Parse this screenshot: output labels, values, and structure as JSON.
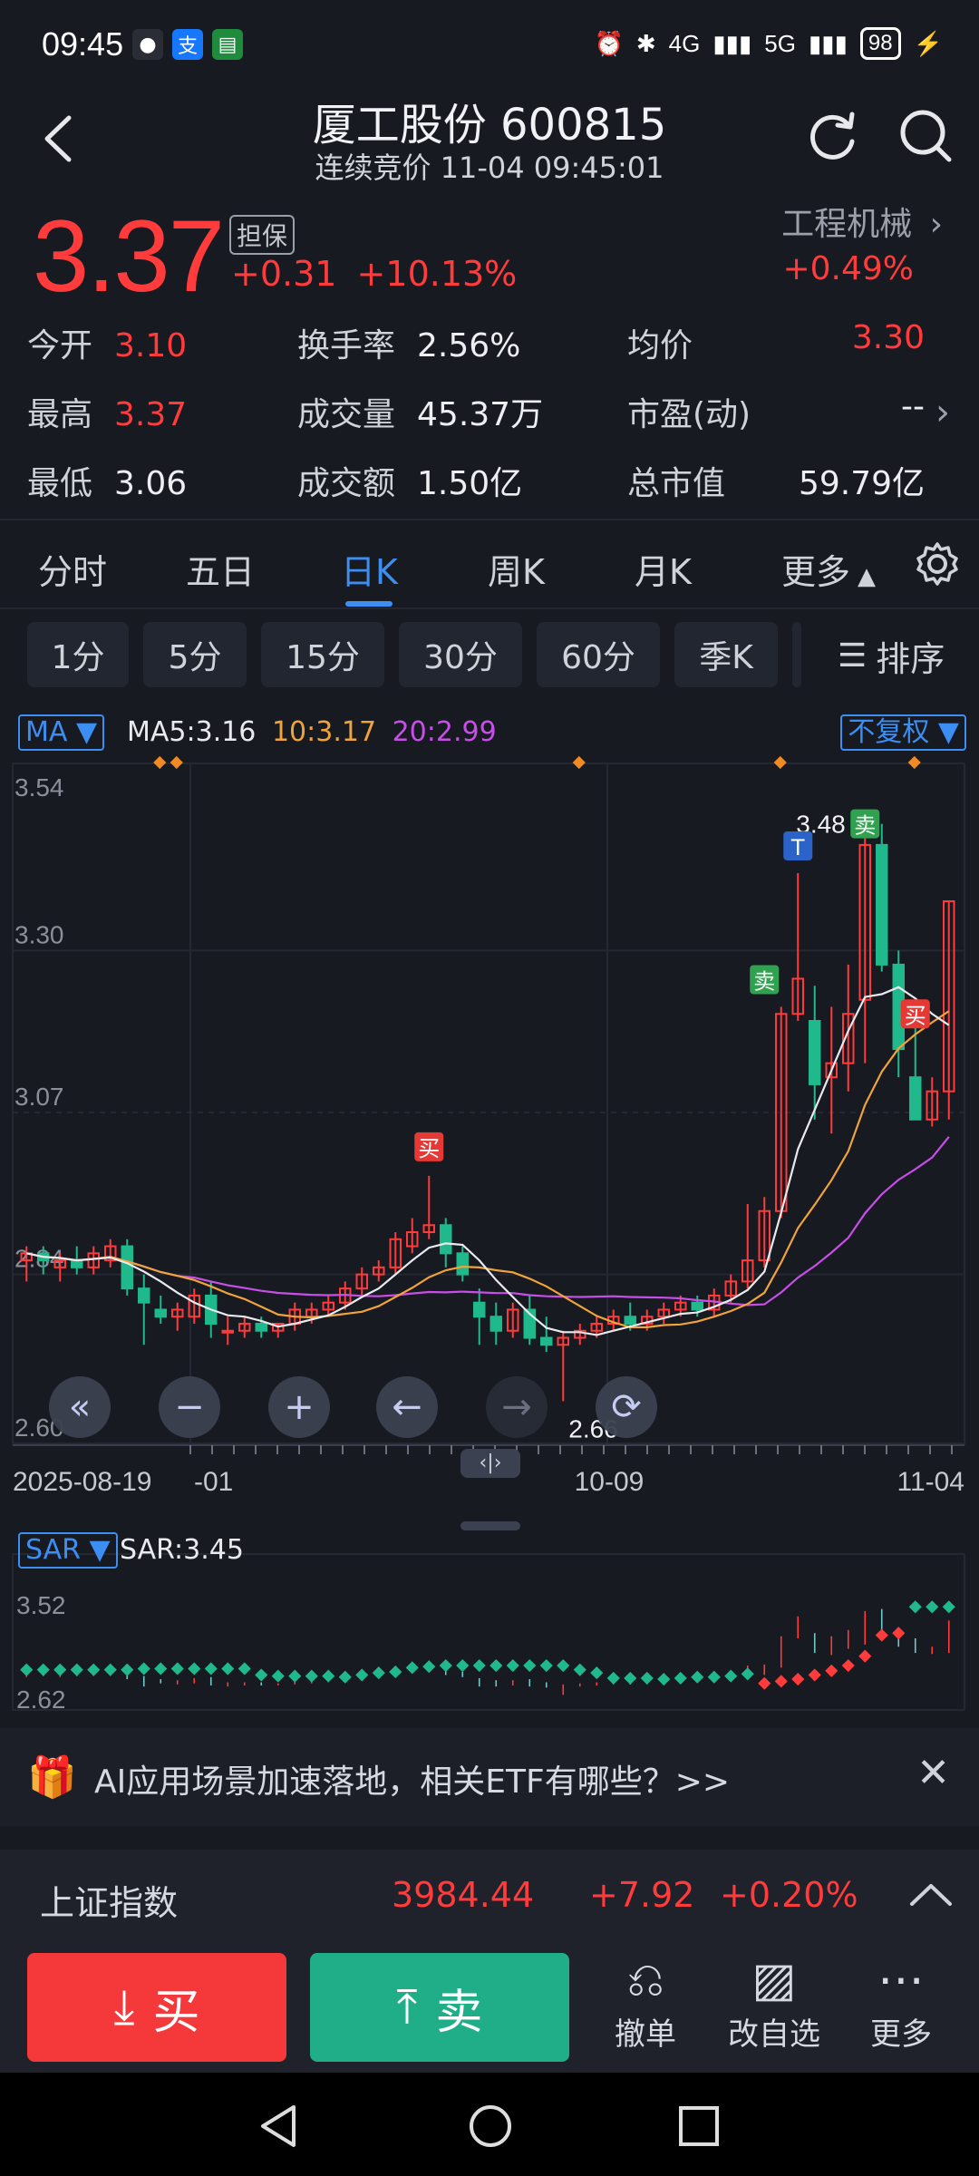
{
  "status": {
    "time": "09:45",
    "battery": "98",
    "net1": "4G",
    "net2": "5G"
  },
  "header": {
    "title": "厦工股份 600815",
    "subtitle": "连续竞价 11-04 09:45:01"
  },
  "quote": {
    "price": "3.37",
    "tag": "担保",
    "change": "+0.31",
    "change_pct": "+10.13%",
    "industry": "工程机械",
    "industry_change": "+0.49%"
  },
  "stats": [
    {
      "label": "今开",
      "value": "3.10"
    },
    {
      "label": "换手率",
      "value": "2.56%"
    },
    {
      "label": "均价",
      "value": "3.30"
    },
    {
      "label": "最高",
      "value": "3.37"
    },
    {
      "label": "成交量",
      "value": "45.37万"
    },
    {
      "label": "市盈(动)",
      "value": "--"
    },
    {
      "label": "最低",
      "value": "3.06"
    },
    {
      "label": "成交额",
      "value": "1.50亿"
    },
    {
      "label": "总市值",
      "value": "59.79亿"
    }
  ],
  "tabs": [
    "分时",
    "五日",
    "日K",
    "周K",
    "月K",
    "更多"
  ],
  "periods": [
    "1分",
    "5分",
    "15分",
    "30分",
    "60分",
    "季K"
  ],
  "sort_label": "排序",
  "ma": {
    "label": "MA",
    "ma5": "MA5:3.16",
    "ma10": "10:3.17",
    "ma20": "20:2.99",
    "adjust": "不复权"
  },
  "chart_data": {
    "type": "candlestick",
    "y_ticks": [
      "3.54",
      "3.30",
      "3.07",
      "2.84",
      "2.60"
    ],
    "x_ticks": [
      "2025-08-19",
      "-01",
      "10-09",
      "11-04"
    ],
    "annotations": {
      "high_label": "3.48",
      "low_label": "2.66",
      "marker_buy": "买",
      "marker_sell": "卖",
      "marker_t": "T"
    },
    "candles": [
      {
        "o": 2.86,
        "h": 2.88,
        "l": 2.83,
        "c": 2.87
      },
      {
        "o": 2.87,
        "h": 2.88,
        "l": 2.84,
        "c": 2.86
      },
      {
        "o": 2.85,
        "h": 2.87,
        "l": 2.83,
        "c": 2.86
      },
      {
        "o": 2.86,
        "h": 2.88,
        "l": 2.84,
        "c": 2.85
      },
      {
        "o": 2.85,
        "h": 2.88,
        "l": 2.84,
        "c": 2.87
      },
      {
        "o": 2.86,
        "h": 2.89,
        "l": 2.85,
        "c": 2.88
      },
      {
        "o": 2.88,
        "h": 2.89,
        "l": 2.81,
        "c": 2.82
      },
      {
        "o": 2.82,
        "h": 2.84,
        "l": 2.74,
        "c": 2.8
      },
      {
        "o": 2.79,
        "h": 2.81,
        "l": 2.77,
        "c": 2.78
      },
      {
        "o": 2.78,
        "h": 2.8,
        "l": 2.76,
        "c": 2.79
      },
      {
        "o": 2.78,
        "h": 2.82,
        "l": 2.77,
        "c": 2.81
      },
      {
        "o": 2.81,
        "h": 2.83,
        "l": 2.75,
        "c": 2.77
      },
      {
        "o": 2.76,
        "h": 2.78,
        "l": 2.74,
        "c": 2.76
      },
      {
        "o": 2.76,
        "h": 2.78,
        "l": 2.75,
        "c": 2.77
      },
      {
        "o": 2.77,
        "h": 2.78,
        "l": 2.75,
        "c": 2.76
      },
      {
        "o": 2.76,
        "h": 2.77,
        "l": 2.75,
        "c": 2.77
      },
      {
        "o": 2.77,
        "h": 2.8,
        "l": 2.76,
        "c": 2.79
      },
      {
        "o": 2.78,
        "h": 2.8,
        "l": 2.77,
        "c": 2.79
      },
      {
        "o": 2.79,
        "h": 2.81,
        "l": 2.78,
        "c": 2.8
      },
      {
        "o": 2.8,
        "h": 2.83,
        "l": 2.79,
        "c": 2.82
      },
      {
        "o": 2.82,
        "h": 2.85,
        "l": 2.81,
        "c": 2.84
      },
      {
        "o": 2.84,
        "h": 2.86,
        "l": 2.83,
        "c": 2.85
      },
      {
        "o": 2.85,
        "h": 2.9,
        "l": 2.84,
        "c": 2.89
      },
      {
        "o": 2.88,
        "h": 2.92,
        "l": 2.87,
        "c": 2.9
      },
      {
        "o": 2.9,
        "h": 2.98,
        "l": 2.89,
        "c": 2.91
      },
      {
        "o": 2.91,
        "h": 2.92,
        "l": 2.85,
        "c": 2.87
      },
      {
        "o": 2.87,
        "h": 2.88,
        "l": 2.83,
        "c": 2.84
      },
      {
        "o": 2.8,
        "h": 2.82,
        "l": 2.74,
        "c": 2.78
      },
      {
        "o": 2.78,
        "h": 2.8,
        "l": 2.74,
        "c": 2.76
      },
      {
        "o": 2.76,
        "h": 2.8,
        "l": 2.75,
        "c": 2.79
      },
      {
        "o": 2.79,
        "h": 2.81,
        "l": 2.74,
        "c": 2.75
      },
      {
        "o": 2.75,
        "h": 2.78,
        "l": 2.73,
        "c": 2.74
      },
      {
        "o": 2.74,
        "h": 2.76,
        "l": 2.66,
        "c": 2.75
      },
      {
        "o": 2.75,
        "h": 2.77,
        "l": 2.74,
        "c": 2.76
      },
      {
        "o": 2.76,
        "h": 2.78,
        "l": 2.75,
        "c": 2.77
      },
      {
        "o": 2.77,
        "h": 2.79,
        "l": 2.76,
        "c": 2.78
      },
      {
        "o": 2.78,
        "h": 2.8,
        "l": 2.76,
        "c": 2.77
      },
      {
        "o": 2.77,
        "h": 2.79,
        "l": 2.76,
        "c": 2.78
      },
      {
        "o": 2.78,
        "h": 2.8,
        "l": 2.77,
        "c": 2.79
      },
      {
        "o": 2.79,
        "h": 2.81,
        "l": 2.78,
        "c": 2.8
      },
      {
        "o": 2.8,
        "h": 2.81,
        "l": 2.78,
        "c": 2.79
      },
      {
        "o": 2.79,
        "h": 2.82,
        "l": 2.78,
        "c": 2.81
      },
      {
        "o": 2.81,
        "h": 2.84,
        "l": 2.8,
        "c": 2.83
      },
      {
        "o": 2.83,
        "h": 2.94,
        "l": 2.82,
        "c": 2.86
      },
      {
        "o": 2.86,
        "h": 2.95,
        "l": 2.85,
        "c": 2.93
      },
      {
        "o": 2.93,
        "h": 3.22,
        "l": 2.92,
        "c": 3.21
      },
      {
        "o": 3.21,
        "h": 3.41,
        "l": 3.2,
        "c": 3.26
      },
      {
        "o": 3.2,
        "h": 3.25,
        "l": 3.06,
        "c": 3.11
      },
      {
        "o": 3.12,
        "h": 3.22,
        "l": 3.04,
        "c": 3.14
      },
      {
        "o": 3.14,
        "h": 3.28,
        "l": 3.1,
        "c": 3.21
      },
      {
        "o": 3.23,
        "h": 3.46,
        "l": 3.14,
        "c": 3.45
      },
      {
        "o": 3.45,
        "h": 3.48,
        "l": 3.27,
        "c": 3.28
      },
      {
        "o": 3.28,
        "h": 3.3,
        "l": 3.12,
        "c": 3.16
      },
      {
        "o": 3.12,
        "h": 3.2,
        "l": 3.06,
        "c": 3.06
      },
      {
        "o": 3.06,
        "h": 3.12,
        "l": 3.05,
        "c": 3.1
      },
      {
        "o": 3.1,
        "h": 3.37,
        "l": 3.06,
        "c": 3.37
      }
    ]
  },
  "sar": {
    "label": "SAR",
    "value": "SAR:3.45",
    "y_ticks": [
      "3.52",
      "2.62"
    ]
  },
  "banner": {
    "text": "AI应用场景加速落地，相关ETF有哪些？>>"
  },
  "index": {
    "name": "上证指数",
    "value": "3984.44",
    "change": "+7.92",
    "pct": "+0.20%"
  },
  "actions": {
    "buy": "买",
    "sell": "卖",
    "cancel": "撤单",
    "edit_watch": "改自选",
    "more": "更多"
  },
  "colors": {
    "up": "#ff3b3b",
    "down": "#1fb98c",
    "accent": "#3c8ef2",
    "bg": "#171a21"
  }
}
